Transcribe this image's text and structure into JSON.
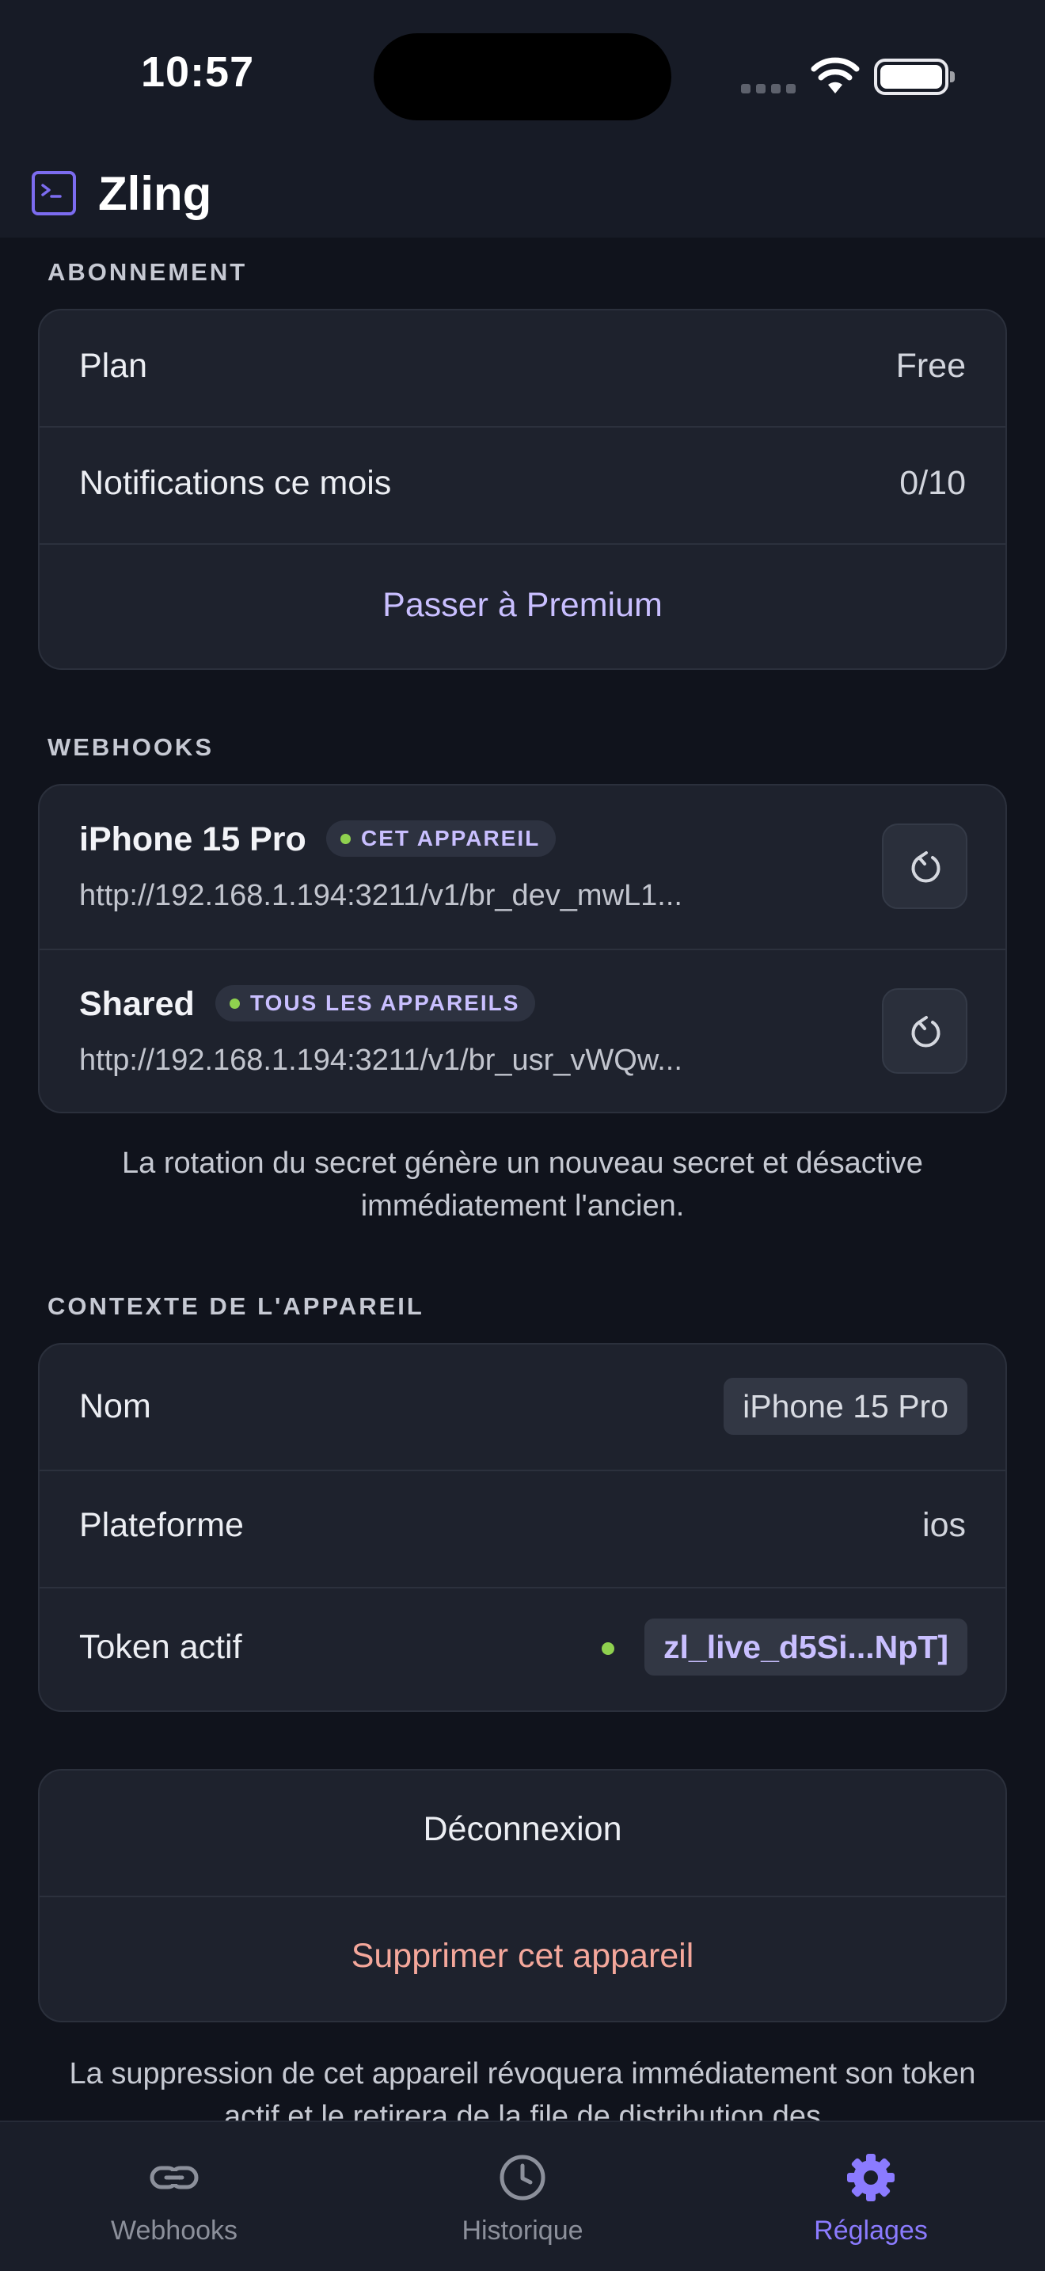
{
  "status_bar": {
    "time": "10:57"
  },
  "app": {
    "title": "Zling"
  },
  "subscription": {
    "section_label": "ABONNEMENT",
    "plan_label": "Plan",
    "plan_value": "Free",
    "notifications_label": "Notifications ce mois",
    "notifications_value": "0/10",
    "upgrade_label": "Passer à Premium"
  },
  "webhooks": {
    "section_label": "WEBHOOKS",
    "items": [
      {
        "name": "iPhone 15 Pro",
        "badge": "CET APPAREIL",
        "url": "http://192.168.1.194:3211/v1/br_dev_mwL1..."
      },
      {
        "name": "Shared",
        "badge": "TOUS LES APPAREILS",
        "url": "http://192.168.1.194:3211/v1/br_usr_vWQw..."
      }
    ],
    "note": "La rotation du secret génère un nouveau secret et désactive immédiatement l'ancien."
  },
  "device": {
    "section_label": "CONTEXTE DE L'APPAREIL",
    "name_label": "Nom",
    "name_value": "iPhone 15 Pro",
    "platform_label": "Plateforme",
    "platform_value": "ios",
    "token_label": "Token actif",
    "token_value": "zl_live_d5Si...NpT]"
  },
  "actions": {
    "logout_label": "Déconnexion",
    "delete_label": "Supprimer cet appareil",
    "note": "La suppression de cet appareil révoquera immédiatement son token actif et le retirera de la file de distribution des"
  },
  "tabs": [
    {
      "label": "Webhooks",
      "icon": "link-icon",
      "active": false
    },
    {
      "label": "Historique",
      "icon": "clock-icon",
      "active": false
    },
    {
      "label": "Réglages",
      "icon": "gear-icon",
      "active": true
    }
  ],
  "colors": {
    "background": "#10131c",
    "card": "#1e222d",
    "accent": "#8b7bff",
    "link": "#c9bfff",
    "danger": "#f4a79b",
    "status_green": "#8fd14f"
  }
}
